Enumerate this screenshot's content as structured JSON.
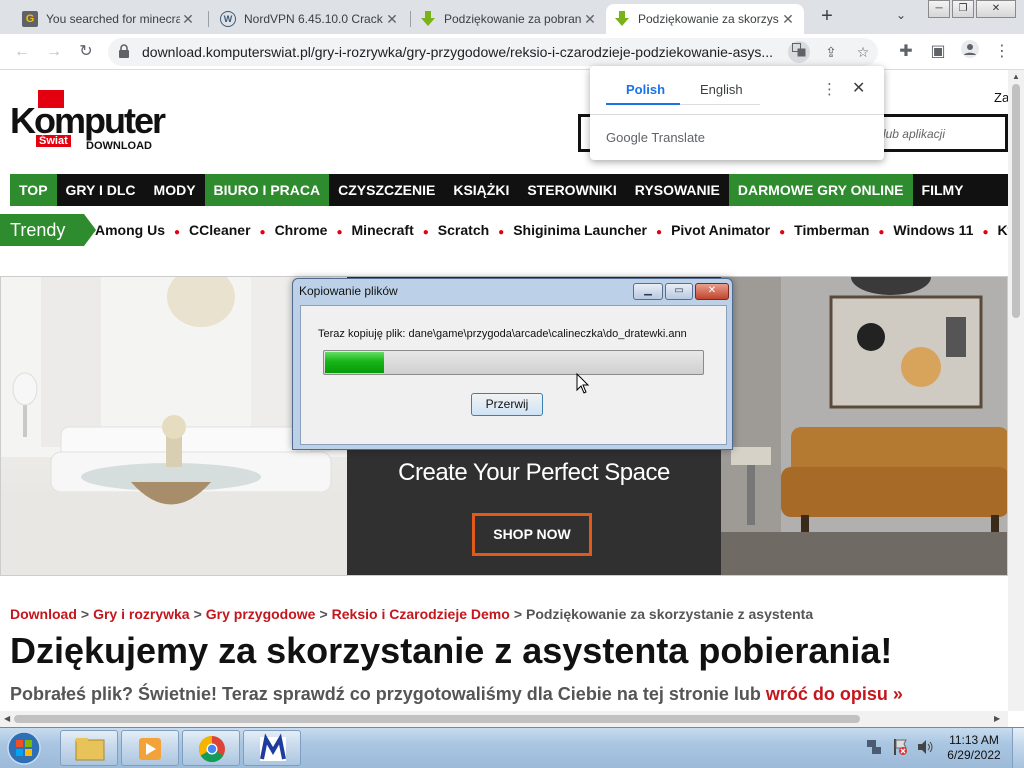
{
  "browser": {
    "tabs": [
      {
        "title": "You searched for minecra",
        "icon": "g-favicon-icon"
      },
      {
        "title": "NordVPN 6.45.10.0 Crack",
        "icon": "wordpress-favicon-icon"
      },
      {
        "title": "Podziękowanie za pobran",
        "icon": "download-favicon-icon"
      },
      {
        "title": "Podziękowanie za skorzys",
        "icon": "download-favicon-icon"
      }
    ],
    "url": "download.komputerswiat.pl/gry-i-rozrywka/gry-przygodowe/reksio-i-czarodzieje-podziekowanie-asys..."
  },
  "translate_popup": {
    "lang_source": "Polish",
    "lang_target": "English",
    "brand_google": "Google",
    "brand_translate": "Translate"
  },
  "site": {
    "logo_text": "Komputer",
    "logo_sub": "Świat",
    "logo_download": "DOWNLOAD",
    "header_right": "Za",
    "search_placeholder": "lub aplikacji",
    "nav": [
      {
        "label": "TOP",
        "green": true
      },
      {
        "label": "GRY I DLC",
        "green": false
      },
      {
        "label": "MODY",
        "green": false
      },
      {
        "label": "BIURO I PRACA",
        "green": true
      },
      {
        "label": "CZYSZCZENIE",
        "green": false
      },
      {
        "label": "KSIĄŻKI",
        "green": false
      },
      {
        "label": "STEROWNIKI",
        "green": false
      },
      {
        "label": "RYSOWANIE",
        "green": false
      },
      {
        "label": "DARMOWE GRY ONLINE",
        "green": true
      },
      {
        "label": "FILMY",
        "green": false
      }
    ],
    "trendy_label": "Trendy",
    "trendy": [
      "Among Us",
      "CCleaner",
      "Chrome",
      "Minecraft",
      "Scratch",
      "Shiginima Launcher",
      "Pivot Animator",
      "Timberman",
      "Windows 11",
      "Kwarant"
    ],
    "ad": {
      "headline": "Create Your Perfect Space",
      "cta": "SHOP NOW"
    },
    "breadcrumb": {
      "links": [
        "Download",
        "Gry i rozrywka",
        "Gry przygodowe",
        "Reksio i Czarodzieje Demo"
      ],
      "current": "Podziękowanie za skorzystanie z asystenta"
    },
    "heading": "Dziękujemy za skorzystanie z asystenta pobierania!",
    "subheading": "Pobrałeś plik? Świetnie! Teraz sprawdź co przygotowaliśmy dla Ciebie na tej stronie lub",
    "subheading_link": "wróć do opisu »"
  },
  "copy_dialog": {
    "title": "Kopiowanie plików",
    "message": "Teraz kopiuję plik: dane\\game\\przygoda\\arcade\\calineczka\\do_dratewki.ann",
    "progress": 0.16,
    "cancel_label": "Przerwij"
  },
  "taskbar": {
    "time": "11:13 AM",
    "date": "6/29/2022"
  }
}
